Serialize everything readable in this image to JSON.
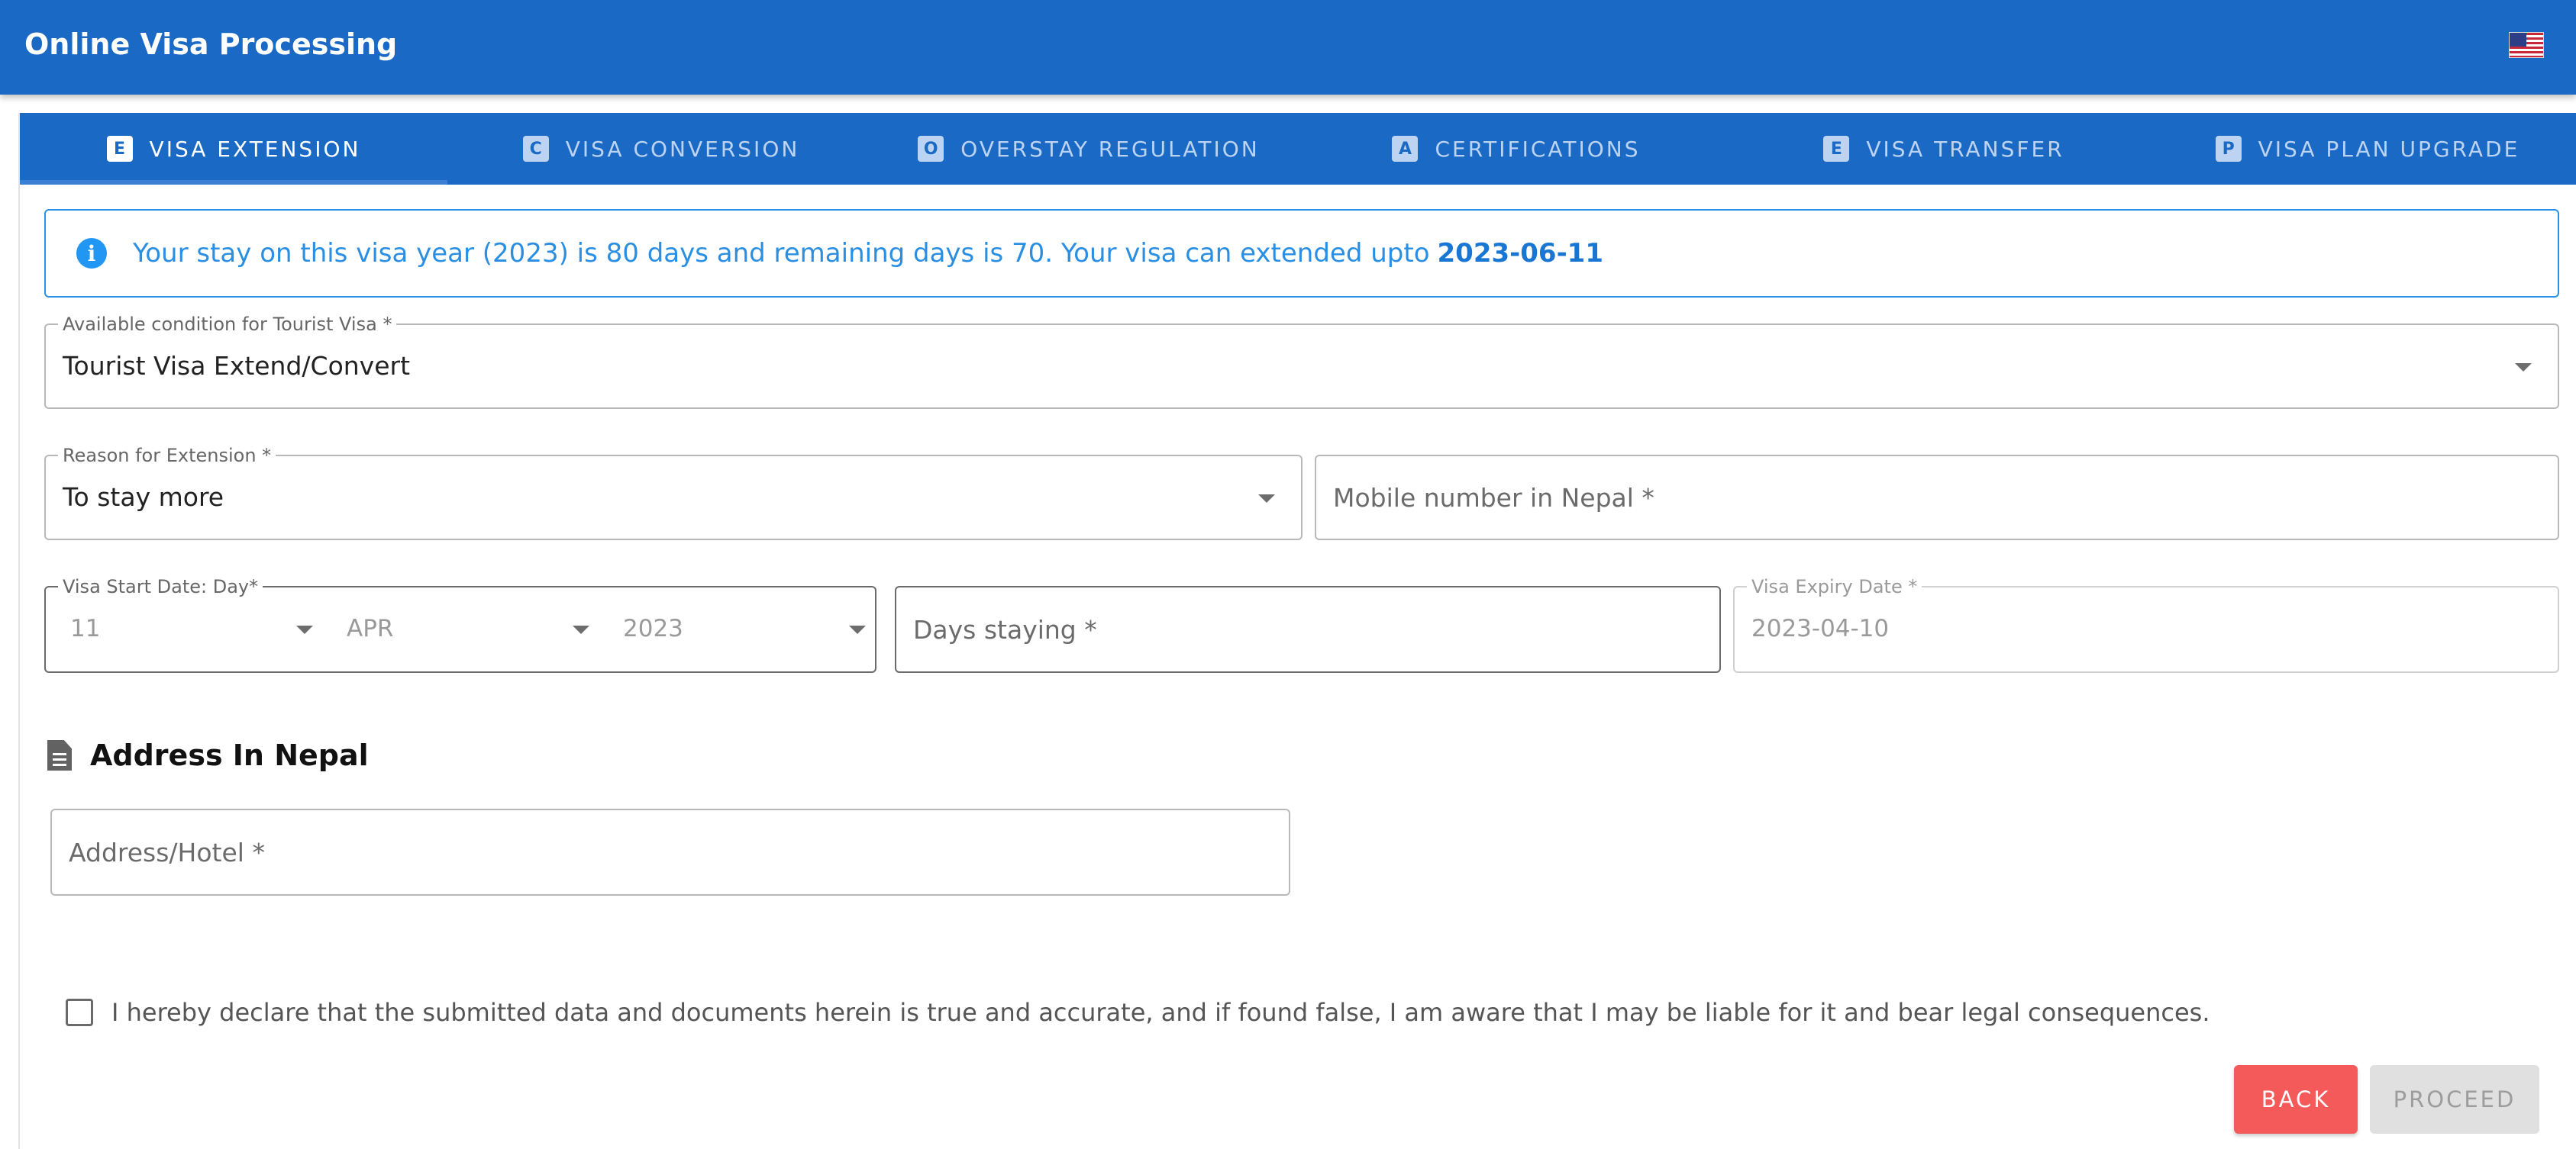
{
  "app": {
    "title": "Online Visa Processing",
    "language_flag_icon": "us-flag-icon"
  },
  "tabs": [
    {
      "letter": "E",
      "label": "VISA EXTENSION",
      "active": true
    },
    {
      "letter": "C",
      "label": "VISA CONVERSION",
      "active": false
    },
    {
      "letter": "O",
      "label": "OVERSTAY REGULATION",
      "active": false
    },
    {
      "letter": "A",
      "label": "CERTIFICATIONS",
      "active": false
    },
    {
      "letter": "E",
      "label": "VISA TRANSFER",
      "active": false
    },
    {
      "letter": "P",
      "label": "VISA PLAN UPGRADE",
      "active": false
    }
  ],
  "alert": {
    "icon": "info-icon",
    "message": "Your stay on this visa year (2023) is 80 days and remaining days is 70. Your visa can extended upto",
    "date": "2023-06-11"
  },
  "form": {
    "condition": {
      "label": "Available condition for Tourist Visa *",
      "value": "Tourist Visa Extend/Convert"
    },
    "reason": {
      "label": "Reason for Extension *",
      "value": "To stay more"
    },
    "mobile": {
      "placeholder": "Mobile number in Nepal *"
    },
    "start_date": {
      "label": "Visa Start Date: Day*",
      "day": "11",
      "month": "APR",
      "year": "2023"
    },
    "days_staying": {
      "placeholder": "Days staying *"
    },
    "expiry": {
      "label": "Visa Expiry Date *",
      "value": "2023-04-10"
    },
    "address_section": {
      "title": "Address In Nepal",
      "icon": "document-icon"
    },
    "address": {
      "placeholder": "Address/Hotel *"
    },
    "declaration": "I hereby declare that the submitted data and documents herein is true and accurate, and if found false, I am aware that I may be liable for it and bear legal consequences."
  },
  "buttons": {
    "back": "BACK",
    "proceed": "PROCEED"
  },
  "colors": {
    "primary": "#1a69c4",
    "alert_text": "#2a8fe2",
    "back_button": "#f55a5a",
    "disabled_button": "#e0e0e0"
  }
}
